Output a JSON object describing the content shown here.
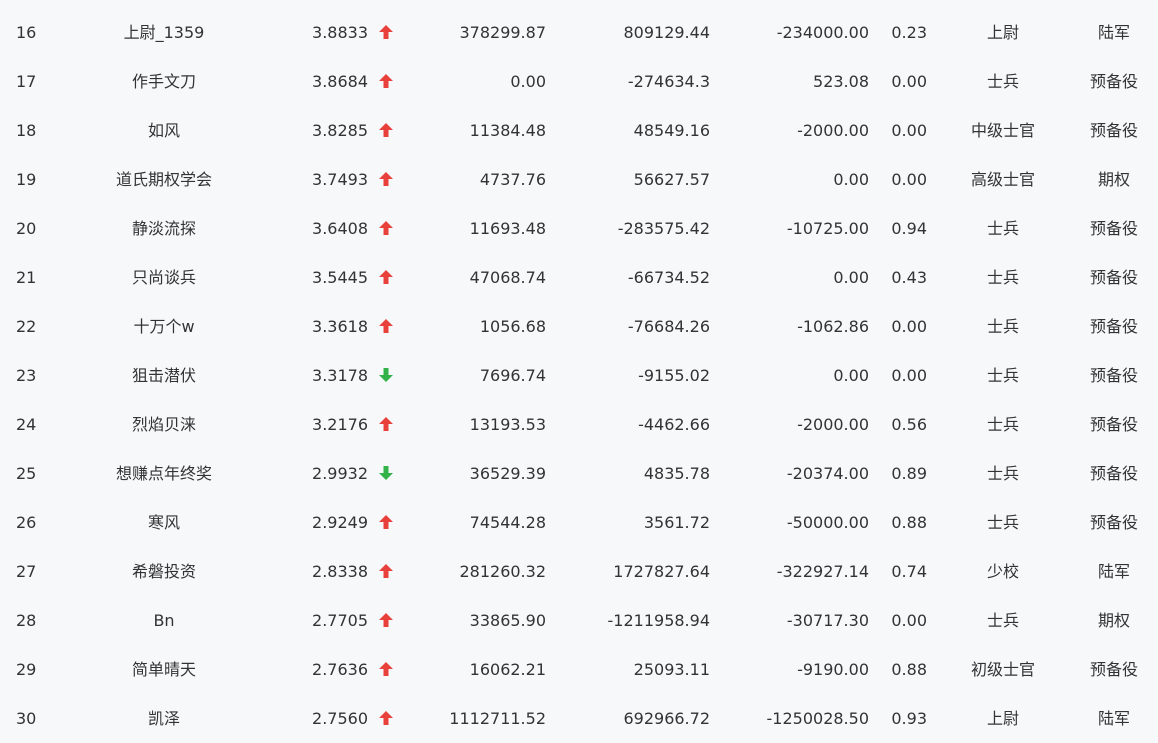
{
  "colors": {
    "up": "#e8403a",
    "down": "#33b24a",
    "background": "#f7f8fa",
    "text": "#333333"
  },
  "rows": [
    {
      "rank": "16",
      "name": "上尉_1359",
      "score": "3.8833",
      "trend": "up",
      "v1": "378299.87",
      "v2": "809129.44",
      "v3": "-234000.00",
      "ratio": "0.23",
      "title": "上尉",
      "group": "陆军"
    },
    {
      "rank": "17",
      "name": "作手文刀",
      "score": "3.8684",
      "trend": "up",
      "v1": "0.00",
      "v2": "-274634.3",
      "v3": "523.08",
      "ratio": "0.00",
      "title": "士兵",
      "group": "预备役"
    },
    {
      "rank": "18",
      "name": "如风",
      "score": "3.8285",
      "trend": "up",
      "v1": "11384.48",
      "v2": "48549.16",
      "v3": "-2000.00",
      "ratio": "0.00",
      "title": "中级士官",
      "group": "预备役"
    },
    {
      "rank": "19",
      "name": "道氏期权学会",
      "score": "3.7493",
      "trend": "up",
      "v1": "4737.76",
      "v2": "56627.57",
      "v3": "0.00",
      "ratio": "0.00",
      "title": "高级士官",
      "group": "期权"
    },
    {
      "rank": "20",
      "name": "静淡流探",
      "score": "3.6408",
      "trend": "up",
      "v1": "11693.48",
      "v2": "-283575.42",
      "v3": "-10725.00",
      "ratio": "0.94",
      "title": "士兵",
      "group": "预备役"
    },
    {
      "rank": "21",
      "name": "只尚谈兵",
      "score": "3.5445",
      "trend": "up",
      "v1": "47068.74",
      "v2": "-66734.52",
      "v3": "0.00",
      "ratio": "0.43",
      "title": "士兵",
      "group": "预备役"
    },
    {
      "rank": "22",
      "name": "十万个w",
      "score": "3.3618",
      "trend": "up",
      "v1": "1056.68",
      "v2": "-76684.26",
      "v3": "-1062.86",
      "ratio": "0.00",
      "title": "士兵",
      "group": "预备役"
    },
    {
      "rank": "23",
      "name": "狙击潜伏",
      "score": "3.3178",
      "trend": "down",
      "v1": "7696.74",
      "v2": "-9155.02",
      "v3": "0.00",
      "ratio": "0.00",
      "title": "士兵",
      "group": "预备役"
    },
    {
      "rank": "24",
      "name": "烈焰贝涞",
      "score": "3.2176",
      "trend": "up",
      "v1": "13193.53",
      "v2": "-4462.66",
      "v3": "-2000.00",
      "ratio": "0.56",
      "title": "士兵",
      "group": "预备役"
    },
    {
      "rank": "25",
      "name": "想赚点年终奖",
      "score": "2.9932",
      "trend": "down",
      "v1": "36529.39",
      "v2": "4835.78",
      "v3": "-20374.00",
      "ratio": "0.89",
      "title": "士兵",
      "group": "预备役"
    },
    {
      "rank": "26",
      "name": "寒风",
      "score": "2.9249",
      "trend": "up",
      "v1": "74544.28",
      "v2": "3561.72",
      "v3": "-50000.00",
      "ratio": "0.88",
      "title": "士兵",
      "group": "预备役"
    },
    {
      "rank": "27",
      "name": "希磐投资",
      "score": "2.8338",
      "trend": "up",
      "v1": "281260.32",
      "v2": "1727827.64",
      "v3": "-322927.14",
      "ratio": "0.74",
      "title": "少校",
      "group": "陆军"
    },
    {
      "rank": "28",
      "name": "Bn",
      "score": "2.7705",
      "trend": "up",
      "v1": "33865.90",
      "v2": "-1211958.94",
      "v3": "-30717.30",
      "ratio": "0.00",
      "title": "士兵",
      "group": "期权"
    },
    {
      "rank": "29",
      "name": "简单晴天",
      "score": "2.7636",
      "trend": "up",
      "v1": "16062.21",
      "v2": "25093.11",
      "v3": "-9190.00",
      "ratio": "0.88",
      "title": "初级士官",
      "group": "预备役"
    },
    {
      "rank": "30",
      "name": "凯泽",
      "score": "2.7560",
      "trend": "up",
      "v1": "1112711.52",
      "v2": "692966.72",
      "v3": "-1250028.50",
      "ratio": "0.93",
      "title": "上尉",
      "group": "陆军"
    }
  ]
}
